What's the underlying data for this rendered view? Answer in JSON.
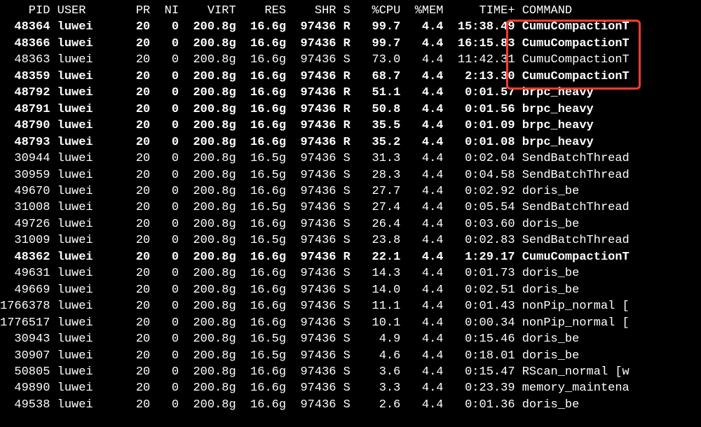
{
  "header": {
    "PID": "PID",
    "USER": "USER",
    "PR": "PR",
    "NI": "NI",
    "VIRT": "VIRT",
    "RES": "RES",
    "SHR": "SHR",
    "S": "S",
    "CPU": "%CPU",
    "MEM": "%MEM",
    "TIME": "TIME+",
    "COMMAND": "COMMAND"
  },
  "rows": [
    {
      "pid": "48364",
      "user": "luwei",
      "pr": "20",
      "ni": "0",
      "virt": "200.8g",
      "res": "16.6g",
      "shr": "97436",
      "s": "R",
      "cpu": "99.7",
      "mem": "4.4",
      "time": "15:38.49",
      "cmd": "CumuCompactionT",
      "bold": true
    },
    {
      "pid": "48366",
      "user": "luwei",
      "pr": "20",
      "ni": "0",
      "virt": "200.8g",
      "res": "16.6g",
      "shr": "97436",
      "s": "R",
      "cpu": "99.7",
      "mem": "4.4",
      "time": "16:15.83",
      "cmd": "CumuCompactionT",
      "bold": true
    },
    {
      "pid": "48363",
      "user": "luwei",
      "pr": "20",
      "ni": "0",
      "virt": "200.8g",
      "res": "16.6g",
      "shr": "97436",
      "s": "S",
      "cpu": "73.0",
      "mem": "4.4",
      "time": "11:42.31",
      "cmd": "CumuCompactionT",
      "bold": false
    },
    {
      "pid": "48359",
      "user": "luwei",
      "pr": "20",
      "ni": "0",
      "virt": "200.8g",
      "res": "16.6g",
      "shr": "97436",
      "s": "R",
      "cpu": "68.7",
      "mem": "4.4",
      "time": "2:13.30",
      "cmd": "CumuCompactionT",
      "bold": true
    },
    {
      "pid": "48792",
      "user": "luwei",
      "pr": "20",
      "ni": "0",
      "virt": "200.8g",
      "res": "16.6g",
      "shr": "97436",
      "s": "R",
      "cpu": "51.1",
      "mem": "4.4",
      "time": "0:01.57",
      "cmd": "brpc_heavy",
      "bold": true
    },
    {
      "pid": "48791",
      "user": "luwei",
      "pr": "20",
      "ni": "0",
      "virt": "200.8g",
      "res": "16.6g",
      "shr": "97436",
      "s": "R",
      "cpu": "50.8",
      "mem": "4.4",
      "time": "0:01.56",
      "cmd": "brpc_heavy",
      "bold": true
    },
    {
      "pid": "48790",
      "user": "luwei",
      "pr": "20",
      "ni": "0",
      "virt": "200.8g",
      "res": "16.6g",
      "shr": "97436",
      "s": "R",
      "cpu": "35.5",
      "mem": "4.4",
      "time": "0:01.09",
      "cmd": "brpc_heavy",
      "bold": true
    },
    {
      "pid": "48793",
      "user": "luwei",
      "pr": "20",
      "ni": "0",
      "virt": "200.8g",
      "res": "16.6g",
      "shr": "97436",
      "s": "R",
      "cpu": "35.2",
      "mem": "4.4",
      "time": "0:01.08",
      "cmd": "brpc_heavy",
      "bold": true
    },
    {
      "pid": "30944",
      "user": "luwei",
      "pr": "20",
      "ni": "0",
      "virt": "200.8g",
      "res": "16.5g",
      "shr": "97436",
      "s": "S",
      "cpu": "31.3",
      "mem": "4.4",
      "time": "0:02.04",
      "cmd": "SendBatchThread",
      "bold": false
    },
    {
      "pid": "30959",
      "user": "luwei",
      "pr": "20",
      "ni": "0",
      "virt": "200.8g",
      "res": "16.5g",
      "shr": "97436",
      "s": "S",
      "cpu": "28.3",
      "mem": "4.4",
      "time": "0:04.58",
      "cmd": "SendBatchThread",
      "bold": false
    },
    {
      "pid": "49670",
      "user": "luwei",
      "pr": "20",
      "ni": "0",
      "virt": "200.8g",
      "res": "16.6g",
      "shr": "97436",
      "s": "S",
      "cpu": "27.7",
      "mem": "4.4",
      "time": "0:02.92",
      "cmd": "doris_be",
      "bold": false
    },
    {
      "pid": "31008",
      "user": "luwei",
      "pr": "20",
      "ni": "0",
      "virt": "200.8g",
      "res": "16.5g",
      "shr": "97436",
      "s": "S",
      "cpu": "27.4",
      "mem": "4.4",
      "time": "0:05.54",
      "cmd": "SendBatchThread",
      "bold": false
    },
    {
      "pid": "49726",
      "user": "luwei",
      "pr": "20",
      "ni": "0",
      "virt": "200.8g",
      "res": "16.6g",
      "shr": "97436",
      "s": "S",
      "cpu": "26.4",
      "mem": "4.4",
      "time": "0:03.60",
      "cmd": "doris_be",
      "bold": false
    },
    {
      "pid": "31009",
      "user": "luwei",
      "pr": "20",
      "ni": "0",
      "virt": "200.8g",
      "res": "16.5g",
      "shr": "97436",
      "s": "S",
      "cpu": "23.8",
      "mem": "4.4",
      "time": "0:02.83",
      "cmd": "SendBatchThread",
      "bold": false
    },
    {
      "pid": "48362",
      "user": "luwei",
      "pr": "20",
      "ni": "0",
      "virt": "200.8g",
      "res": "16.6g",
      "shr": "97436",
      "s": "R",
      "cpu": "22.1",
      "mem": "4.4",
      "time": "1:29.17",
      "cmd": "CumuCompactionT",
      "bold": true
    },
    {
      "pid": "49631",
      "user": "luwei",
      "pr": "20",
      "ni": "0",
      "virt": "200.8g",
      "res": "16.6g",
      "shr": "97436",
      "s": "S",
      "cpu": "14.3",
      "mem": "4.4",
      "time": "0:01.73",
      "cmd": "doris_be",
      "bold": false
    },
    {
      "pid": "49669",
      "user": "luwei",
      "pr": "20",
      "ni": "0",
      "virt": "200.8g",
      "res": "16.6g",
      "shr": "97436",
      "s": "S",
      "cpu": "14.0",
      "mem": "4.4",
      "time": "0:02.51",
      "cmd": "doris_be",
      "bold": false
    },
    {
      "pid": "1766378",
      "user": "luwei",
      "pr": "20",
      "ni": "0",
      "virt": "200.8g",
      "res": "16.6g",
      "shr": "97436",
      "s": "S",
      "cpu": "11.1",
      "mem": "4.4",
      "time": "0:01.43",
      "cmd": "nonPip_normal [",
      "bold": false
    },
    {
      "pid": "1776517",
      "user": "luwei",
      "pr": "20",
      "ni": "0",
      "virt": "200.8g",
      "res": "16.6g",
      "shr": "97436",
      "s": "S",
      "cpu": "10.1",
      "mem": "4.4",
      "time": "0:00.34",
      "cmd": "nonPip_normal [",
      "bold": false
    },
    {
      "pid": "30943",
      "user": "luwei",
      "pr": "20",
      "ni": "0",
      "virt": "200.8g",
      "res": "16.5g",
      "shr": "97436",
      "s": "S",
      "cpu": "4.9",
      "mem": "4.4",
      "time": "0:15.46",
      "cmd": "doris_be",
      "bold": false
    },
    {
      "pid": "30907",
      "user": "luwei",
      "pr": "20",
      "ni": "0",
      "virt": "200.8g",
      "res": "16.5g",
      "shr": "97436",
      "s": "S",
      "cpu": "4.6",
      "mem": "4.4",
      "time": "0:18.01",
      "cmd": "doris_be",
      "bold": false
    },
    {
      "pid": "50805",
      "user": "luwei",
      "pr": "20",
      "ni": "0",
      "virt": "200.8g",
      "res": "16.6g",
      "shr": "97436",
      "s": "S",
      "cpu": "3.6",
      "mem": "4.4",
      "time": "0:15.47",
      "cmd": "RScan_normal [w",
      "bold": false
    },
    {
      "pid": "49890",
      "user": "luwei",
      "pr": "20",
      "ni": "0",
      "virt": "200.8g",
      "res": "16.6g",
      "shr": "97436",
      "s": "S",
      "cpu": "3.3",
      "mem": "4.4",
      "time": "0:23.39",
      "cmd": "memory_maintena",
      "bold": false
    },
    {
      "pid": "49538",
      "user": "luwei",
      "pr": "20",
      "ni": "0",
      "virt": "200.8g",
      "res": "16.6g",
      "shr": "97436",
      "s": "S",
      "cpu": "2.6",
      "mem": "4.4",
      "time": "0:01.36",
      "cmd": "doris_be",
      "bold": false
    }
  ],
  "widths": {
    "pid": 7,
    "user": 9,
    "pr": 4,
    "ni": 4,
    "virt": 8,
    "res": 7,
    "shr": 7,
    "s": 2,
    "cpu": 6,
    "mem": 6,
    "time": 10
  }
}
